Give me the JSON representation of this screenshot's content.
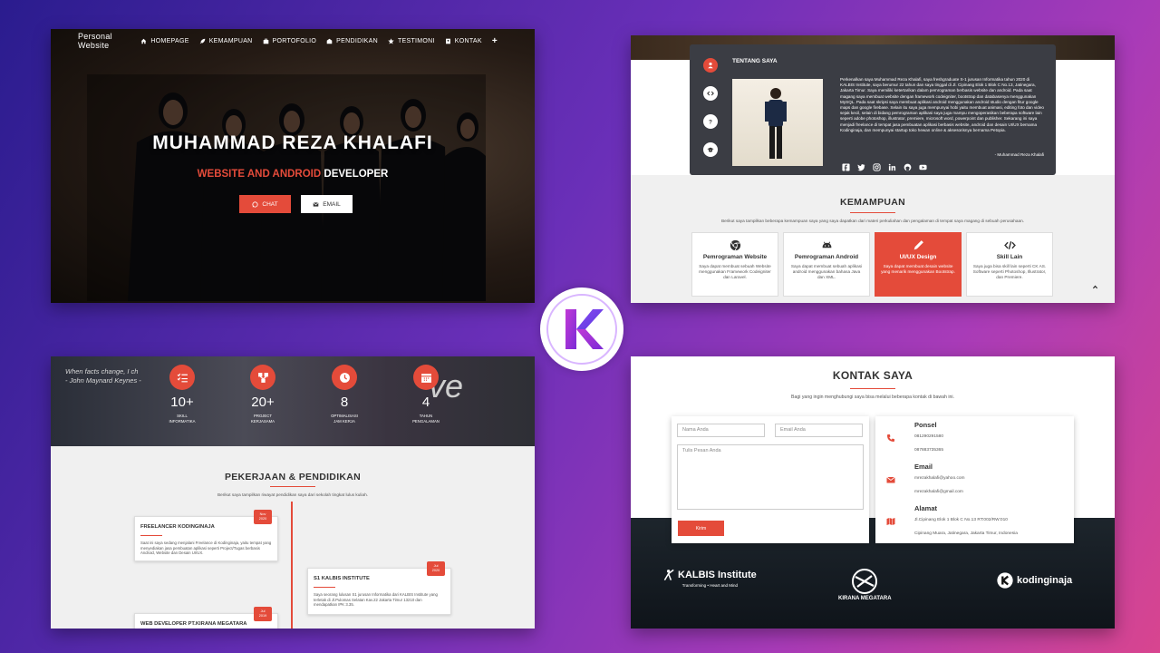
{
  "hero": {
    "brand": "Personal Website",
    "nav": [
      {
        "label": "HOMEPAGE",
        "icon": "home-icon"
      },
      {
        "label": "KEMAMPUAN",
        "icon": "rocket-icon"
      },
      {
        "label": "PORTOFOLIO",
        "icon": "briefcase-icon"
      },
      {
        "label": "PENDIDIKAN",
        "icon": "school-icon"
      },
      {
        "label": "TESTIMONI",
        "icon": "star-icon"
      },
      {
        "label": "KONTAK",
        "icon": "contact-icon"
      }
    ],
    "plus": "+",
    "name": "MUHAMMAD REZA KHALAFI",
    "role_red": "WEBSITE AND ANDROID",
    "role_white": "DEVELOPER",
    "chat_label": "CHAT",
    "email_label": "EMAIL"
  },
  "about": {
    "title": "TENTANG SAYA",
    "text": "Perkenalkan saya Muhammad Reza Khalafi, saya freshgraduate S-1 jurusan Informatika tahun 2020 di KALBIS Institute, saya berumur 22 tahun dan saya tinggal di Jl. Cipinang Elok 1 Blok C No.13, Jatinegara, Jakarta Timur. Saya memiliki ketertarikan dalam pemrograman berbasis website dan android. Pada saat magang saya membuat website dengan framework codeigniter, bootstrap dan databasenya menggunakan MySQL. Pada saat skripsi saya membuat aplikasi android menggunakan android studio dengan fitur google maps dan google firebase. Selain itu saya juga mempunyai hobi yaitu membuat animasi, editing foto dan video sejak kecil, selain di bidang pemrograman aplikasi saya juga mampu mengoperasikan beberapa software lain seperti adobe photoshop, illustrator, premiere, microsoft word, powerpoint dan publisher. Sekarang ini saya menjadi freelance di tempat jasa pembuatan aplikasi berbasis website, android dan desain UI/UX bernama Kodinginaja, dan mempunyai startup toko hewan online & aksesorisnya bernama Petopia.",
    "signature": "- Muhammad Reza Khalafi"
  },
  "skills": {
    "title": "KEMAMPUAN",
    "desc": "Berikut saya tampilkan beberapa kemampuan saya yang saya dapatkan dari materi perkuliahan dan pengalaman di tempat saya magang di sebuah perusahaan.",
    "cards": [
      {
        "name": "Pemrograman Website",
        "text": "Saya dapat membuat sebuah Website menggunakan Framework Codeigniter dan Laravel.",
        "icon": "chrome-icon"
      },
      {
        "name": "Pemrograman Android",
        "text": "Saya dapat membuat sebuah aplikasi android menggunakan bahasa Java dan XML.",
        "icon": "android-icon"
      },
      {
        "name": "UI/UX Design",
        "text": "Saya dapat membuat desain website yang menarik menggunakan Bootstrap.",
        "icon": "pen-icon"
      },
      {
        "name": "Skill Lain",
        "text": "Saya juga bisa skill lain seperti CK AS. Software seperti Photoshop, Illustrator, dan Premiere.",
        "icon": "code-icon"
      }
    ]
  },
  "stats": {
    "quote_line1": "When facts change, I ch",
    "quote_line2": "- John Maynard Keynes -",
    "bg_word": "ve",
    "items": [
      {
        "num": "10+",
        "label1": "SKILL",
        "label2": "INFORMATIKA"
      },
      {
        "num": "20+",
        "label1": "PROJECT",
        "label2": "KERJASAMA"
      },
      {
        "num": "8",
        "label1": "OPTIMALISASI",
        "label2": "JAM KERJA"
      },
      {
        "num": "4",
        "label1": "TAHUN",
        "label2": "PENGALAMAN"
      }
    ]
  },
  "education": {
    "title": "PEKERJAAN & PENDIDIKAN",
    "desc": "Berikut saya tampilkan riwayat pendidikan saya dari sekolah tingkat lulus kuliah.",
    "items": [
      {
        "title": "FREELANCER KODINGINAJA",
        "date1": "Nov",
        "date2": "2020",
        "text": "Saat ini saya sedang menjalani Freelance di Kodinginaja, yaitu tempat yang menyediakan jasa pembuatan aplikasi seperti Project/Tugas berbasis Android, Website dan Desain UI/UX."
      },
      {
        "title": "S1 KALBIS INSTITUTE",
        "date1": "Jul",
        "date2": "2020",
        "text": "Saya seorang lulusan S1 jurusan Informatika dari KALBIS Institute yang terletak di Jl.Pulomas Selatan Kav.22 Jakarta Timur 13210 dan mendapatkan IPK 3.35."
      },
      {
        "title": "WEB DEVELOPER PT.KIRANA MEGATARA",
        "date1": "Jul",
        "date2": "2019",
        "text": ""
      }
    ]
  },
  "contact": {
    "title": "KONTAK SAYA",
    "desc": "Bagi yang ingin menghubungi saya bisa melalui beberapa kontak di bawah ini.",
    "name_placeholder": "Nama Anda",
    "email_placeholder": "Email Anda",
    "message_placeholder": "Tulis Pesan Anda",
    "send_label": "Kirim",
    "phone_title": "Ponsel",
    "phone1": "081290291580",
    "phone2": "087883735365",
    "email_title": "Email",
    "email1": "mrezakhalafi@yahoo.com",
    "email2": "mrezakhalafi@gmail.com",
    "address_title": "Alamat",
    "address1": "Jl.Cipinang Elok 1 Blok C No.13 RT:002/RW:010",
    "address2": "Cipinang Muara, Jatinegara, Jakarta Timur, Indonesia"
  },
  "logos": {
    "kalbis": "KALBIS Institute",
    "kalbis_tag": "Transforming • Heart and Mind",
    "kirana": "KIRANA MEGATARA",
    "kodinginaja": "kodinginaja"
  },
  "colors": {
    "accent": "#e44b3a",
    "card_dark": "#3b3d44"
  }
}
